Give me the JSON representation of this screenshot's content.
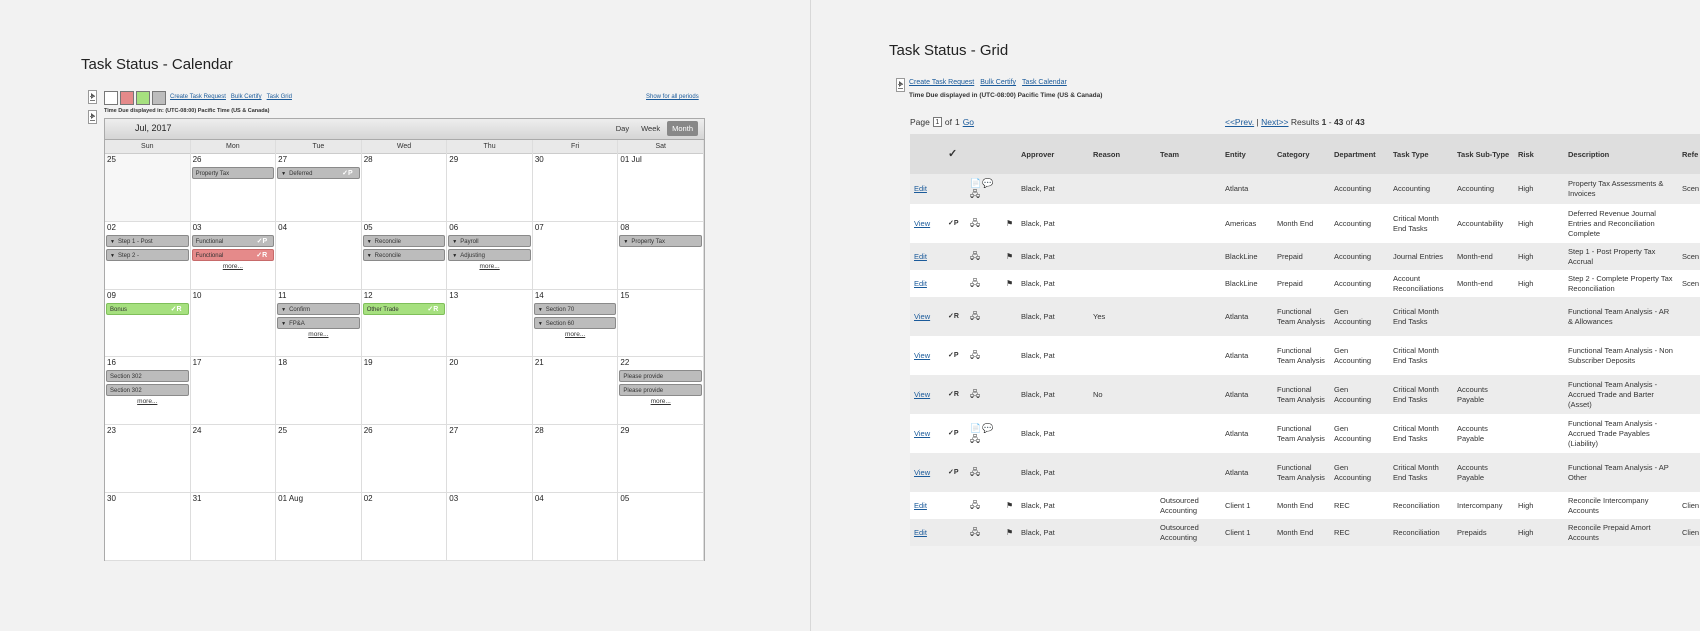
{
  "calendar_panel": {
    "title": "Task Status - Calendar",
    "links": [
      "Create Task Request",
      "Bulk Certify",
      "Task Grid"
    ],
    "show_all": "Show for all periods",
    "timezone": "Time Due displayed in: (UTC-08:00) Pacific Time (US & Canada)",
    "swatch_colors": [
      "#ffffff",
      "#e58a8a",
      "#a6e07f",
      "#bcbcbc"
    ],
    "month_label": "Jul, 2017",
    "views": [
      "Day",
      "Week",
      "Month"
    ],
    "active_view": "Month",
    "weekdays": [
      "Sun",
      "Mon",
      "Tue",
      "Wed",
      "Thu",
      "Fri",
      "Sat"
    ],
    "weeks": [
      {
        "days": [
          {
            "num": "25",
            "shade": true,
            "events": []
          },
          {
            "num": "26",
            "events": [
              {
                "label": "Property Tax",
                "color": "grey"
              }
            ]
          },
          {
            "num": "27",
            "events": [
              {
                "label": "Deferred",
                "color": "grey",
                "tri": true,
                "badge": "✓P"
              }
            ]
          },
          {
            "num": "28",
            "events": []
          },
          {
            "num": "29",
            "events": []
          },
          {
            "num": "30",
            "events": []
          },
          {
            "num": "01 Jul",
            "events": []
          }
        ]
      },
      {
        "days": [
          {
            "num": "02",
            "events": [
              {
                "label": "Step 1 - Post",
                "color": "grey",
                "tri": true
              },
              {
                "label": "Step 2 -",
                "color": "grey",
                "tri": true
              }
            ]
          },
          {
            "num": "03",
            "events": [
              {
                "label": "Functional",
                "color": "grey",
                "badge": "✓P"
              },
              {
                "label": "Functional",
                "color": "red",
                "badge": "✓R"
              }
            ],
            "more": "more..."
          },
          {
            "num": "04",
            "events": []
          },
          {
            "num": "05",
            "events": [
              {
                "label": "Reconcile",
                "color": "grey",
                "tri": true
              },
              {
                "label": "Reconcile",
                "color": "grey",
                "tri": true
              }
            ]
          },
          {
            "num": "06",
            "events": [
              {
                "label": "Payroll",
                "color": "grey",
                "tri": true
              },
              {
                "label": "Adjusting",
                "color": "grey",
                "tri": true
              }
            ],
            "more": "more..."
          },
          {
            "num": "07",
            "events": []
          },
          {
            "num": "08",
            "events": [
              {
                "label": "Property Tax",
                "color": "grey",
                "tri": true
              }
            ]
          }
        ]
      },
      {
        "days": [
          {
            "num": "09",
            "events": [
              {
                "label": "Bonus",
                "color": "green",
                "badge": "✓R"
              }
            ]
          },
          {
            "num": "10",
            "events": []
          },
          {
            "num": "11",
            "events": [
              {
                "label": "Confirm",
                "color": "grey",
                "tri": true
              },
              {
                "label": "FP&A",
                "color": "grey",
                "tri": true
              }
            ],
            "more": "more..."
          },
          {
            "num": "12",
            "events": [
              {
                "label": "Other Trade",
                "color": "green",
                "badge": "✓R"
              }
            ]
          },
          {
            "num": "13",
            "events": []
          },
          {
            "num": "14",
            "events": [
              {
                "label": "Section 70",
                "color": "grey",
                "tri": true
              },
              {
                "label": "Section 60",
                "color": "grey",
                "tri": true
              }
            ],
            "more": "more..."
          },
          {
            "num": "15",
            "events": []
          }
        ]
      },
      {
        "days": [
          {
            "num": "16",
            "events": [
              {
                "label": "Section 302",
                "color": "grey"
              },
              {
                "label": "Section 302",
                "color": "grey"
              }
            ],
            "more": "more..."
          },
          {
            "num": "17",
            "events": []
          },
          {
            "num": "18",
            "events": []
          },
          {
            "num": "19",
            "events": []
          },
          {
            "num": "20",
            "events": []
          },
          {
            "num": "21",
            "events": []
          },
          {
            "num": "22",
            "events": [
              {
                "label": "Please provide",
                "color": "grey"
              },
              {
                "label": "Please provide",
                "color": "grey"
              }
            ],
            "more": "more..."
          }
        ]
      },
      {
        "days": [
          {
            "num": "23",
            "events": []
          },
          {
            "num": "24",
            "events": []
          },
          {
            "num": "25",
            "events": []
          },
          {
            "num": "26",
            "events": []
          },
          {
            "num": "27",
            "events": []
          },
          {
            "num": "28",
            "events": []
          },
          {
            "num": "29",
            "events": []
          }
        ]
      },
      {
        "days": [
          {
            "num": "30",
            "events": []
          },
          {
            "num": "31",
            "events": []
          },
          {
            "num": "01 Aug",
            "events": []
          },
          {
            "num": "02",
            "events": []
          },
          {
            "num": "03",
            "events": []
          },
          {
            "num": "04",
            "events": []
          },
          {
            "num": "05",
            "events": []
          }
        ]
      }
    ]
  },
  "grid_panel": {
    "title": "Task Status - Grid",
    "links": [
      "Create Task Request",
      "Bulk Certify",
      "Task Calendar"
    ],
    "timezone": "Time Due displayed in (UTC-08:00) Pacific Time (US & Canada)",
    "pager": {
      "page_label": "Page",
      "page_value": "1",
      "of_label": "of",
      "total_pages": "1",
      "go": "Go"
    },
    "results": {
      "prev": "<<Prev.",
      "sep": "|",
      "next": "Next>>",
      "label": "Results",
      "from": "1",
      "dash": "-",
      "to": "43",
      "of": "of",
      "total": "43"
    },
    "headers": [
      "",
      "✓",
      "",
      "",
      "Approver",
      "Reason",
      "Team",
      "Entity",
      "Category",
      "Department",
      "Task Type",
      "Task Sub-Type",
      "Risk",
      "Description",
      "Refe"
    ],
    "rows": [
      {
        "action": "Edit",
        "check": "",
        "icons": "📄💬🖧",
        "flag": "",
        "approver": "Black, Pat",
        "reason": "",
        "team": "",
        "entity": "Atlanta",
        "category": "",
        "department": "Accounting",
        "task_type": "Accounting",
        "sub_type": "Accounting",
        "risk": "High",
        "description": "Property Tax Assessments & Invoices",
        "ref": "Scen",
        "style": "alt"
      },
      {
        "action": "View",
        "check": "✓P",
        "icons": "🖧",
        "flag": "⚑",
        "approver": "Black, Pat",
        "reason": "",
        "team": "",
        "entity": "Americas",
        "category": "Month End",
        "department": "Accounting",
        "task_type": "Critical Month End Tasks",
        "sub_type": "Accountability",
        "risk": "High",
        "description": "Deferred Revenue Journal Entries and Reconciliation Complete",
        "ref": "",
        "style": "w tall"
      },
      {
        "action": "Edit",
        "check": "",
        "icons": "🖧",
        "flag": "⚑",
        "approver": "Black, Pat",
        "reason": "",
        "team": "",
        "entity": "BlackLine",
        "category": "Prepaid",
        "department": "Accounting",
        "task_type": "Journal Entries",
        "sub_type": "Month-end",
        "risk": "High",
        "description": "Step 1 - Post Property Tax Accrual",
        "ref": "Scen",
        "style": "alt short"
      },
      {
        "action": "Edit",
        "check": "",
        "icons": "🖧",
        "flag": "⚑",
        "approver": "Black, Pat",
        "reason": "",
        "team": "",
        "entity": "BlackLine",
        "category": "Prepaid",
        "department": "Accounting",
        "task_type": "Account Reconciliations",
        "sub_type": "Month-end",
        "risk": "High",
        "description": "Step 2 - Complete Property Tax Reconciliation",
        "ref": "Scen",
        "style": "w short"
      },
      {
        "action": "View",
        "check": "✓R",
        "icons": "🖧",
        "flag": "",
        "approver": "Black, Pat",
        "reason": "Yes",
        "team": "",
        "entity": "Atlanta",
        "category": "Functional Team Analysis",
        "department": "Gen Accounting",
        "task_type": "Critical Month End Tasks",
        "sub_type": "",
        "risk": "",
        "description": "Functional Team Analysis - AR & Allowances",
        "ref": "",
        "style": "alt tall"
      },
      {
        "action": "View",
        "check": "✓P",
        "icons": "🖧",
        "flag": "",
        "approver": "Black, Pat",
        "reason": "",
        "team": "",
        "entity": "Atlanta",
        "category": "Functional Team Analysis",
        "department": "Gen Accounting",
        "task_type": "Critical Month End Tasks",
        "sub_type": "",
        "risk": "",
        "description": "Functional Team Analysis - Non Subscriber Deposits",
        "ref": "",
        "style": "w tall"
      },
      {
        "action": "View",
        "check": "✓R",
        "icons": "🖧",
        "flag": "",
        "approver": "Black, Pat",
        "reason": "No",
        "team": "",
        "entity": "Atlanta",
        "category": "Functional Team Analysis",
        "department": "Gen Accounting",
        "task_type": "Critical Month End Tasks",
        "sub_type": "Accounts Payable",
        "risk": "",
        "description": "Functional Team Analysis - Accrued Trade and Barter (Asset)",
        "ref": "",
        "style": "alt tall"
      },
      {
        "action": "View",
        "check": "✓P",
        "icons": "📄💬🖧",
        "flag": "",
        "approver": "Black, Pat",
        "reason": "",
        "team": "",
        "entity": "Atlanta",
        "category": "Functional Team Analysis",
        "department": "Gen Accounting",
        "task_type": "Critical Month End Tasks",
        "sub_type": "Accounts Payable",
        "risk": "",
        "description": "Functional Team Analysis - Accrued Trade Payables (Liability)",
        "ref": "",
        "style": "w tall"
      },
      {
        "action": "View",
        "check": "✓P",
        "icons": "🖧",
        "flag": "",
        "approver": "Black, Pat",
        "reason": "",
        "team": "",
        "entity": "Atlanta",
        "category": "Functional Team Analysis",
        "department": "Gen Accounting",
        "task_type": "Critical Month End Tasks",
        "sub_type": "Accounts Payable",
        "risk": "",
        "description": "Functional Team Analysis - AP Other",
        "ref": "",
        "style": "alt tall"
      },
      {
        "action": "Edit",
        "check": "",
        "icons": "🖧",
        "flag": "⚑",
        "approver": "Black, Pat",
        "reason": "",
        "team": "Outsourced Accounting",
        "entity": "Client 1",
        "category": "Month End",
        "department": "REC",
        "task_type": "Reconciliation",
        "sub_type": "Intercompany",
        "risk": "High",
        "description": "Reconcile Intercompany Accounts",
        "ref": "Clien",
        "style": "w short"
      },
      {
        "action": "Edit",
        "check": "",
        "icons": "🖧",
        "flag": "⚑",
        "approver": "Black, Pat",
        "reason": "",
        "team": "Outsourced Accounting",
        "entity": "Client 1",
        "category": "Month End",
        "department": "REC",
        "task_type": "Reconciliation",
        "sub_type": "Prepaids",
        "risk": "High",
        "description": "Reconcile Prepaid Amort Accounts",
        "ref": "Clien",
        "style": "alt short"
      }
    ]
  }
}
